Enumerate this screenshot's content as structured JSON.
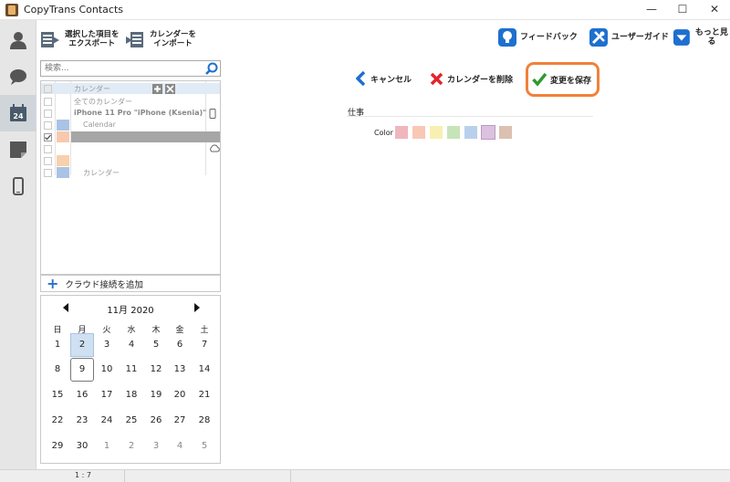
{
  "window": {
    "title": "CopyTrans Contacts",
    "minimize": "—",
    "maximize": "☐",
    "close": "✕"
  },
  "rail": [
    {
      "name": "contacts-icon"
    },
    {
      "name": "messages-icon"
    },
    {
      "name": "calendar-icon",
      "badge": "24"
    },
    {
      "name": "notes-icon"
    },
    {
      "name": "device-icon"
    }
  ],
  "toolbar": {
    "export_line1": "選択した項目を",
    "export_line2": "エクスポート",
    "import_line1": "カレンダーを",
    "import_line2": "インポート",
    "feedback": "フィードバック",
    "guide": "ユーザーガイド",
    "more": "もっと見る"
  },
  "search": {
    "placeholder": "検索..."
  },
  "calendars": {
    "header": "カレンダー",
    "all": "全てのカレンダー",
    "device": "iPhone 11 Pro \"iPhone (Ksenia)\"",
    "calendar1": "Calendar",
    "calendar2": "カレンダー"
  },
  "add_cloud": "クラウド接続を追加",
  "minical": {
    "month": "11月 2020",
    "weekdays": [
      "日",
      "月",
      "火",
      "水",
      "木",
      "金",
      "土"
    ],
    "weeks": [
      [
        "1",
        "2",
        "3",
        "4",
        "5",
        "6",
        "7"
      ],
      [
        "8",
        "9",
        "10",
        "11",
        "12",
        "13",
        "14"
      ],
      [
        "15",
        "16",
        "17",
        "18",
        "19",
        "20",
        "21"
      ],
      [
        "22",
        "23",
        "24",
        "25",
        "26",
        "27",
        "28"
      ],
      [
        "29",
        "30",
        "1",
        "2",
        "3",
        "4",
        "5"
      ]
    ],
    "selected": "2",
    "today": "9"
  },
  "actions": {
    "cancel": "キャンセル",
    "delete": "カレンダーを削除",
    "save": "変更を保存"
  },
  "editor": {
    "name_value": "仕事",
    "color_label": "Color",
    "colors": [
      "#f0b6bd",
      "#f8c8b4",
      "#f8f0b0",
      "#c6e4b8",
      "#b8d0ec",
      "#dcc2e0",
      "#dcc0b0"
    ]
  },
  "status": {
    "count": "1 : 7"
  }
}
